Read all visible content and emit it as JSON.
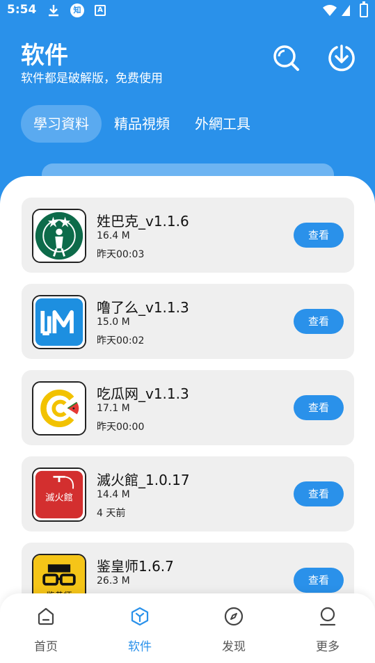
{
  "status_bar": {
    "time": "5:54",
    "zhi_badge": "知",
    "a_badge": "A",
    "icons": [
      "download-icon",
      "zhihu-icon",
      "a-icon",
      "wifi-icon",
      "signal-icon",
      "battery-icon"
    ]
  },
  "header": {
    "title": "软件",
    "subtitle": "软件都是破解版，免费使用",
    "icons": [
      "search-icon",
      "download-icon"
    ]
  },
  "tabs": [
    {
      "label": "學习資料",
      "active": true
    },
    {
      "label": "精品視頻",
      "active": false
    },
    {
      "label": "外網工具",
      "active": false
    }
  ],
  "apps": [
    {
      "name": "姓巴克_v1.1.6",
      "size": "16.4 M",
      "time": "昨天00:03",
      "button": "查看",
      "icon": "starbucks-style-icon"
    },
    {
      "name": "噜了么_v1.1.3",
      "size": "15.0 M",
      "time": "昨天00:02",
      "button": "查看",
      "icon": "lm-logo-icon"
    },
    {
      "name": "吃瓜网_v1.1.3",
      "size": "17.1 M",
      "time": "昨天00:00",
      "button": "查看",
      "icon": "watermelon-c-icon"
    },
    {
      "name": "滅火館_1.0.17",
      "size": "14.4 M",
      "time": "4 天前",
      "button": "查看",
      "icon": "fire-extinguisher-icon",
      "icon_text": "滅火館"
    },
    {
      "name": "鉴皇师1.6.7",
      "size": "26.3 M",
      "time": "",
      "button": "查看",
      "icon": "glasses-face-icon",
      "icon_text": "鉴黄师"
    }
  ],
  "bottom_nav": [
    {
      "label": "首页",
      "icon": "home-icon",
      "active": false
    },
    {
      "label": "软件",
      "icon": "box-icon",
      "active": true
    },
    {
      "label": "发现",
      "icon": "compass-icon",
      "active": false
    },
    {
      "label": "更多",
      "icon": "person-icon",
      "active": false
    }
  ],
  "colors": {
    "primary": "#2a91ea",
    "tab_active": "#5aaaf0",
    "card_bg": "#efefef"
  }
}
